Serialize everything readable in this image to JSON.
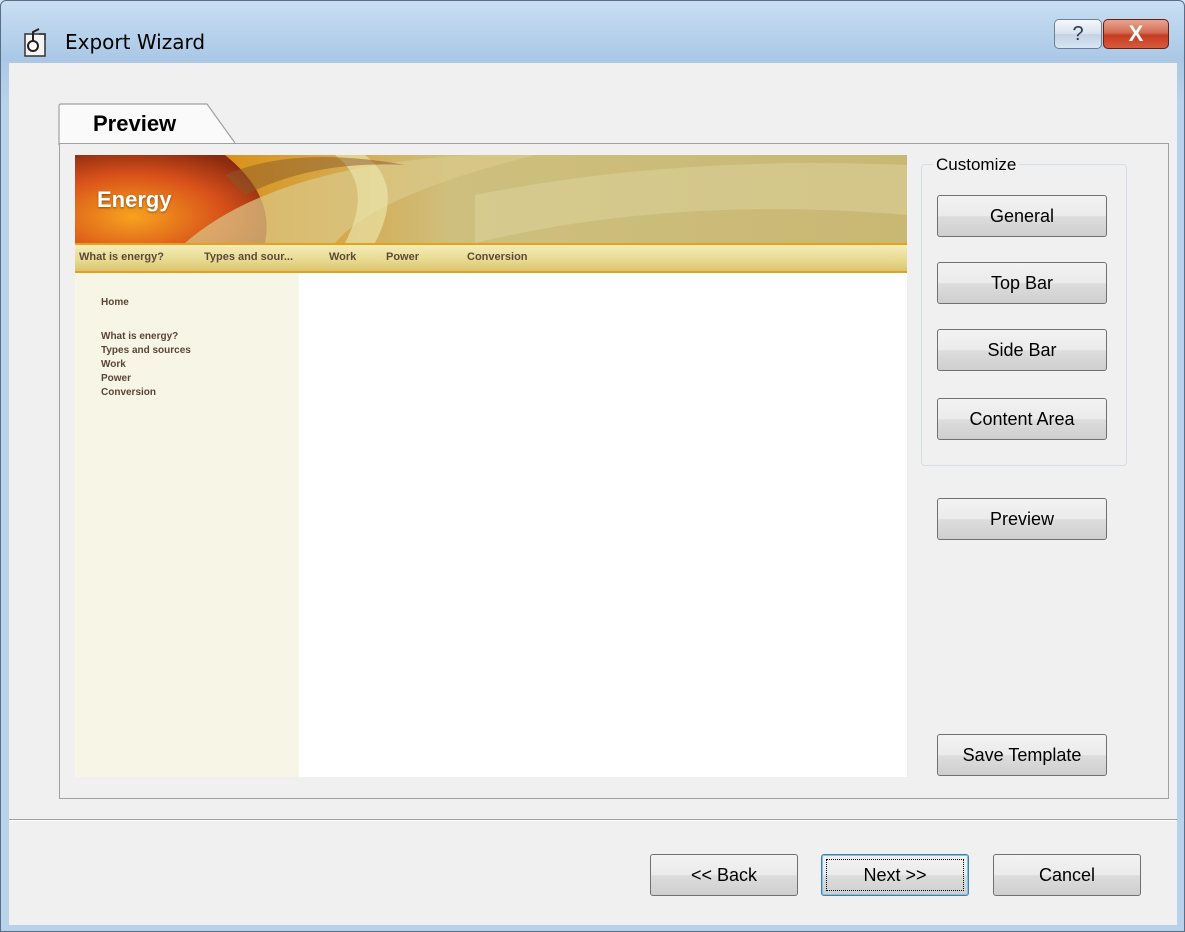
{
  "window": {
    "title": "Export Wizard",
    "help_glyph": "?",
    "close_glyph": "X",
    "icon": "export-wizard-icon"
  },
  "tab": {
    "label": "Preview"
  },
  "preview_site": {
    "banner_title": "Energy",
    "top_nav": [
      "What is energy?",
      "Types and sour...",
      "Work",
      "Power",
      "Conversion"
    ],
    "side_nav": [
      "Home",
      "What is energy?",
      "Types and sources",
      "Work",
      "Power",
      "Conversion"
    ],
    "colors": {
      "nav_border": "#e4a11c",
      "sidebar_bg": "#f6f5e6",
      "banner_bg": "#c9b874"
    }
  },
  "customize": {
    "group_label": "Customize",
    "general": "General",
    "top_bar": "Top Bar",
    "side_bar": "Side Bar",
    "content_area": "Content Area"
  },
  "actions": {
    "preview": "Preview",
    "save_template": "Save Template",
    "back": "<< Back",
    "next": "Next >>",
    "cancel": "Cancel"
  }
}
